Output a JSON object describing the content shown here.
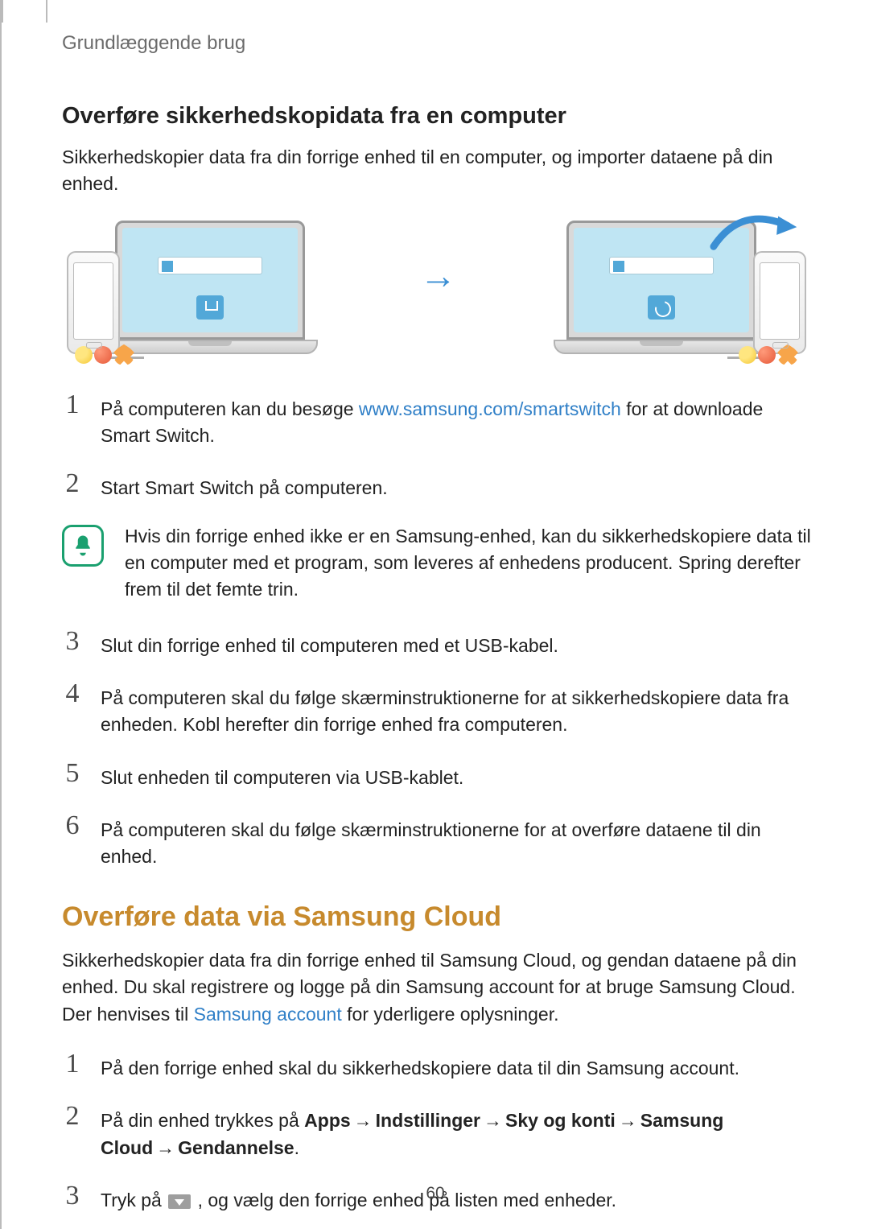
{
  "breadcrumb": "Grundlæggende brug",
  "section1": {
    "heading": "Overføre sikkerhedskopidata fra en computer",
    "intro": "Sikkerhedskopier data fra din forrige enhed til en computer, og importer dataene på din enhed."
  },
  "steps1": {
    "s1_pre": "På computeren kan du besøge ",
    "s1_link": "www.samsung.com/smartswitch",
    "s1_post": " for at downloade Smart Switch.",
    "s2": "Start Smart Switch på computeren.",
    "note": "Hvis din forrige enhed ikke er en Samsung-enhed, kan du sikkerhedskopiere data til en computer med et program, som leveres af enhedens producent. Spring derefter frem til det femte trin.",
    "s3": "Slut din forrige enhed til computeren med et USB-kabel.",
    "s4": "På computeren skal du følge skærminstruktionerne for at sikkerhedskopiere data fra enheden. Kobl herefter din forrige enhed fra computeren.",
    "s5": "Slut enheden til computeren via USB-kablet.",
    "s6": "På computeren skal du følge skærminstruktionerne for at overføre dataene til din enhed."
  },
  "section2": {
    "heading": "Overføre data via Samsung Cloud",
    "intro_pre": "Sikkerhedskopier data fra din forrige enhed til Samsung Cloud, og gendan dataene på din enhed. Du skal registrere og logge på din Samsung account for at bruge Samsung Cloud. Der henvises til ",
    "intro_link": "Samsung account",
    "intro_post": " for yderligere oplysninger."
  },
  "steps2": {
    "s1": "På den forrige enhed skal du sikkerhedskopiere data til din Samsung account.",
    "s2_pre": "På din enhed trykkes på ",
    "s2_path": [
      "Apps",
      "Indstillinger",
      "Sky og konti",
      "Samsung Cloud",
      "Gendannelse"
    ],
    "s3_pre": "Tryk på ",
    "s3_post": " , og vælg den forrige enhed på listen med enheder."
  },
  "nums": {
    "n1": "1",
    "n2": "2",
    "n3": "3",
    "n4": "4",
    "n5": "5",
    "n6": "6"
  },
  "arrow": "→",
  "page_number": "60"
}
